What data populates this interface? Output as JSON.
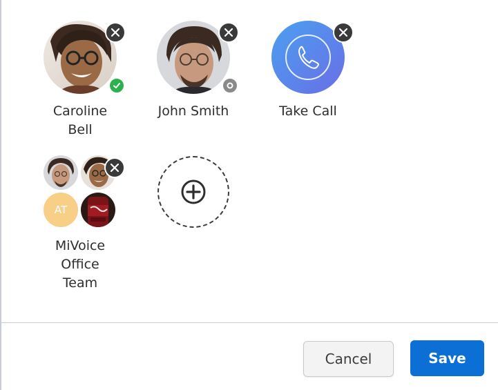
{
  "tiles": [
    {
      "name_line1": "Caroline",
      "name_line2": "Bell",
      "status": "available"
    },
    {
      "name": "John Smith",
      "status": "offline"
    },
    {
      "name": "Take Call"
    },
    {
      "name_line1": "MiVoice",
      "name_line2": "Office",
      "name_line3": "Team",
      "member_initials": "AT"
    }
  ],
  "icons": {
    "remove": "close-icon",
    "add": "plus-circle-icon",
    "phone": "phone-icon",
    "available": "check-icon",
    "offline": "offline-ring-icon"
  },
  "colors": {
    "remove_bg": "#3a3a3a",
    "available": "#2bb24c",
    "offline": "#8a8a8a",
    "call_gradient_start": "#4aa0f0",
    "call_gradient_end": "#6a6ee6",
    "initials_bg": "#f8cf86",
    "save_bg": "#0b6fd6",
    "cancel_bg": "#f3f3f3"
  },
  "footer": {
    "cancel_label": "Cancel",
    "save_label": "Save"
  }
}
